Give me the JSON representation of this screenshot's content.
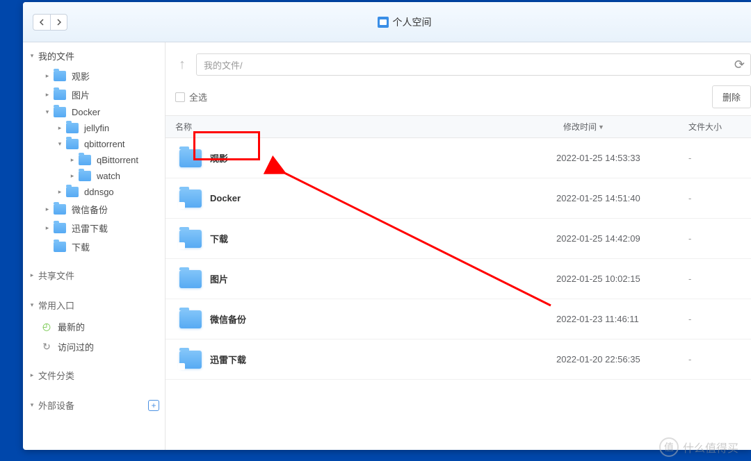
{
  "title": "个人空间",
  "path": "我的文件/",
  "select_all": "全选",
  "btn_delete": "删除",
  "columns": {
    "name": "名称",
    "time": "修改时间",
    "size": "文件大小"
  },
  "sidebar": {
    "my_files": "我的文件",
    "items": [
      {
        "label": "观影",
        "depth": 1,
        "toggle": "▸"
      },
      {
        "label": "图片",
        "depth": 1,
        "toggle": "▸"
      },
      {
        "label": "Docker",
        "depth": 1,
        "toggle": "▾"
      },
      {
        "label": "jellyfin",
        "depth": 2,
        "toggle": "▸"
      },
      {
        "label": "qbittorrent",
        "depth": 2,
        "toggle": "▾"
      },
      {
        "label": "qBittorrent",
        "depth": 3,
        "toggle": "▸"
      },
      {
        "label": "watch",
        "depth": 3,
        "toggle": "▸"
      },
      {
        "label": "ddnsgo",
        "depth": 2,
        "toggle": "▸"
      },
      {
        "label": "微信备份",
        "depth": 1,
        "toggle": "▸"
      },
      {
        "label": "迅雷下载",
        "depth": 1,
        "toggle": "▸"
      },
      {
        "label": "下载",
        "depth": 1,
        "toggle": " "
      }
    ],
    "shared": "共享文件",
    "quick": "常用入口",
    "recent": "最新的",
    "visited": "访问过的",
    "category": "文件分类",
    "external": "外部设备"
  },
  "files": [
    {
      "name": "观影",
      "time": "2022-01-25 14:53:33",
      "size": "-",
      "shared": false
    },
    {
      "name": "Docker",
      "time": "2022-01-25 14:51:40",
      "size": "-",
      "shared": true
    },
    {
      "name": "下载",
      "time": "2022-01-25 14:42:09",
      "size": "-",
      "shared": true
    },
    {
      "name": "图片",
      "time": "2022-01-25 10:02:15",
      "size": "-",
      "shared": false
    },
    {
      "name": "微信备份",
      "time": "2022-01-23 11:46:11",
      "size": "-",
      "shared": false
    },
    {
      "name": "迅雷下载",
      "time": "2022-01-20 22:56:35",
      "size": "-",
      "shared": true
    }
  ],
  "watermark": "什么值得买"
}
